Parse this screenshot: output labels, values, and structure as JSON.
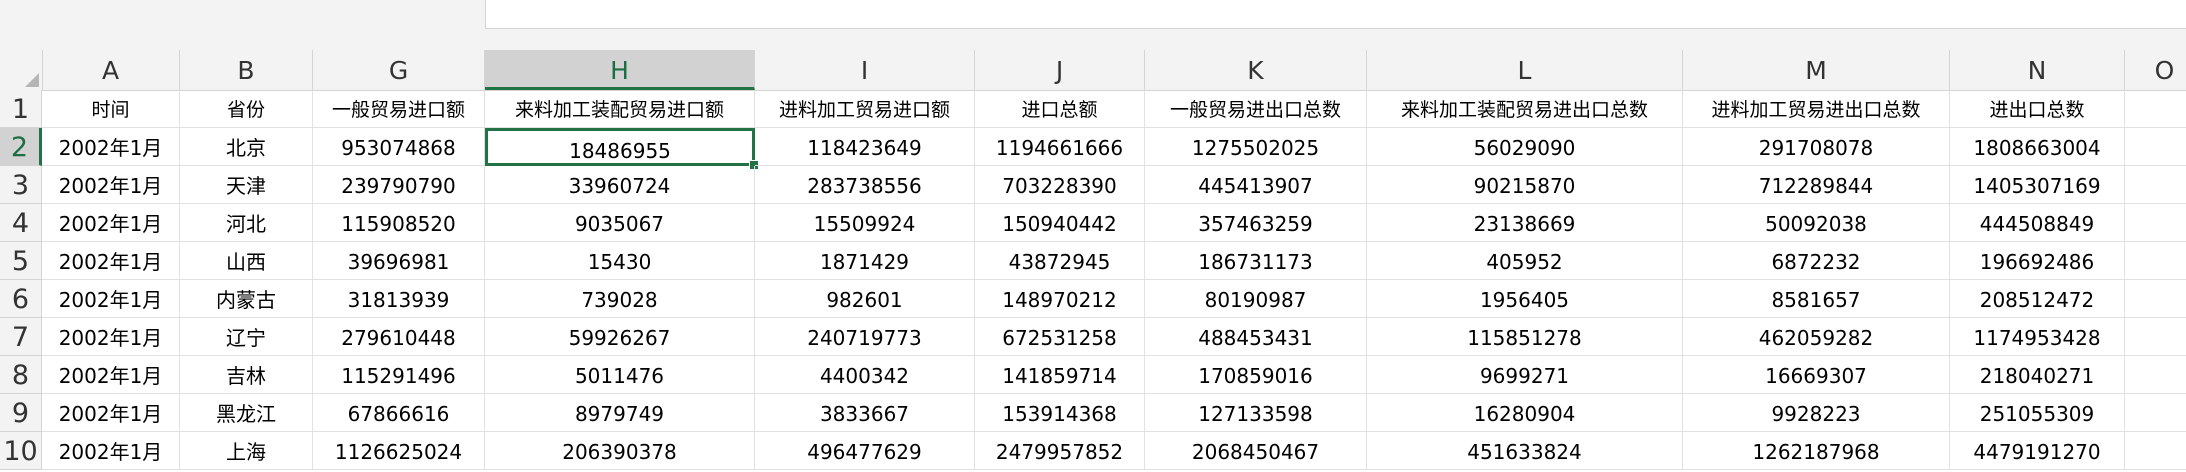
{
  "columns": [
    "A",
    "B",
    "G",
    "H",
    "I",
    "J",
    "K",
    "L",
    "M",
    "N",
    "O"
  ],
  "selected_column": "H",
  "selected_row": "2",
  "rows": [
    {
      "num": "1",
      "cells": [
        "时间",
        "省份",
        "一般贸易进口额",
        "来料加工装配贸易进口额",
        "进料加工贸易进口额",
        "进口总额",
        "一般贸易进出口总数",
        "来料加工装配贸易进出口总数",
        "进料加工贸易进出口总数",
        "进出口总数",
        ""
      ]
    },
    {
      "num": "2",
      "cells": [
        "2002年1月",
        "北京",
        "953074868",
        "18486955",
        "118423649",
        "1194661666",
        "1275502025",
        "56029090",
        "291708078",
        "1808663004",
        ""
      ]
    },
    {
      "num": "3",
      "cells": [
        "2002年1月",
        "天津",
        "239790790",
        "33960724",
        "283738556",
        "703228390",
        "445413907",
        "90215870",
        "712289844",
        "1405307169",
        ""
      ]
    },
    {
      "num": "4",
      "cells": [
        "2002年1月",
        "河北",
        "115908520",
        "9035067",
        "15509924",
        "150940442",
        "357463259",
        "23138669",
        "50092038",
        "444508849",
        ""
      ]
    },
    {
      "num": "5",
      "cells": [
        "2002年1月",
        "山西",
        "39696981",
        "15430",
        "1871429",
        "43872945",
        "186731173",
        "405952",
        "6872232",
        "196692486",
        ""
      ]
    },
    {
      "num": "6",
      "cells": [
        "2002年1月",
        "内蒙古",
        "31813939",
        "739028",
        "982601",
        "148970212",
        "80190987",
        "1956405",
        "8581657",
        "208512472",
        ""
      ]
    },
    {
      "num": "7",
      "cells": [
        "2002年1月",
        "辽宁",
        "279610448",
        "59926267",
        "240719773",
        "672531258",
        "488453431",
        "115851278",
        "462059282",
        "1174953428",
        ""
      ]
    },
    {
      "num": "8",
      "cells": [
        "2002年1月",
        "吉林",
        "115291496",
        "5011476",
        "4400342",
        "141859714",
        "170859016",
        "9699271",
        "16669307",
        "218040271",
        ""
      ]
    },
    {
      "num": "9",
      "cells": [
        "2002年1月",
        "黑龙江",
        "67866616",
        "8979749",
        "3833667",
        "153914368",
        "127133598",
        "16280904",
        "9928223",
        "251055309",
        ""
      ]
    },
    {
      "num": "10",
      "cells": [
        "2002年1月",
        "上海",
        "1126625024",
        "206390378",
        "496477629",
        "2479957852",
        "2068450467",
        "451633824",
        "1262187968",
        "4479191270",
        ""
      ]
    }
  ]
}
